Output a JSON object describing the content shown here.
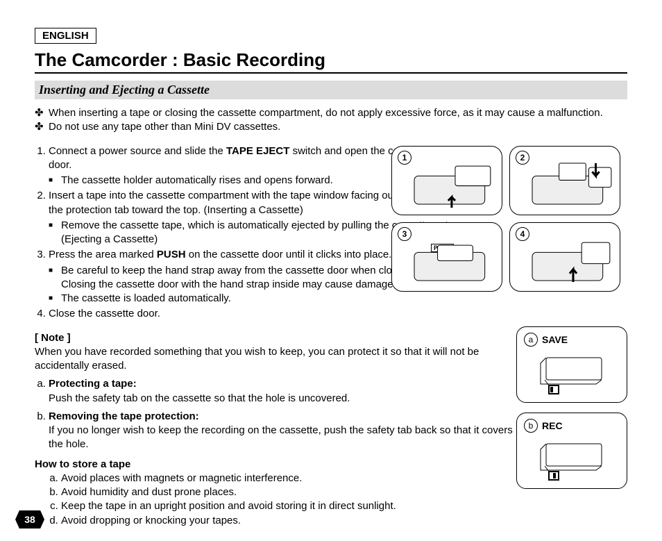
{
  "language": "ENGLISH",
  "title": "The Camcorder : Basic Recording",
  "section": "Inserting and Ejecting a Cassette",
  "warnings": [
    "When inserting a tape or closing the cassette compartment, do not apply excessive force, as it may cause a malfunction.",
    "Do not use any tape other than Mini DV cassettes."
  ],
  "steps": {
    "s1_a": "Connect a power source and slide the ",
    "s1_bold": "TAPE EJECT",
    "s1_b": " switch and open the cassette door.",
    "s1_sub1": "The cassette holder automatically rises and opens forward.",
    "s2": "Insert a tape into the cassette compartment with the tape window facing outward and the protection tab toward the top. (Inserting a Cassette)",
    "s2_sub1": "Remove the cassette tape, which is automatically ejected by pulling the cassette out. (Ejecting a Cassette)",
    "s3_a": "Press the area marked ",
    "s3_bold": "PUSH",
    "s3_b": " on the cassette door until it clicks into place.",
    "s3_sub1": "Be careful to keep the hand strap away from the cassette door when closing it. Closing the cassette door with the hand strap inside may cause damage to the unit.",
    "s3_sub2": "The cassette is loaded automatically.",
    "s4": "Close the cassette door."
  },
  "note": {
    "heading": "[ Note ]",
    "intro": "When you have recorded something that you wish to keep, you can protect it so that it will not be accidentally erased.",
    "a_label": "Protecting a tape:",
    "a_text": "Push the safety tab on the cassette so that the hole is uncovered.",
    "b_label": "Removing the tape protection:",
    "b_text": "If you no longer wish to keep the recording on the cassette, push the safety tab back so that it covers the hole.",
    "store_heading": "How to store a tape",
    "store": [
      "Avoid places with magnets or magnetic interference.",
      "Avoid humidity and dust prone places.",
      "Keep the tape in an upright position and avoid storing it in direct sunlight.",
      "Avoid dropping or knocking your tapes."
    ]
  },
  "figures": {
    "nums": [
      "1",
      "2",
      "3",
      "4"
    ],
    "push_label": "PUSH",
    "save": {
      "letter": "a",
      "label": "SAVE"
    },
    "rec": {
      "letter": "b",
      "label": "REC"
    }
  },
  "page_number": "38"
}
